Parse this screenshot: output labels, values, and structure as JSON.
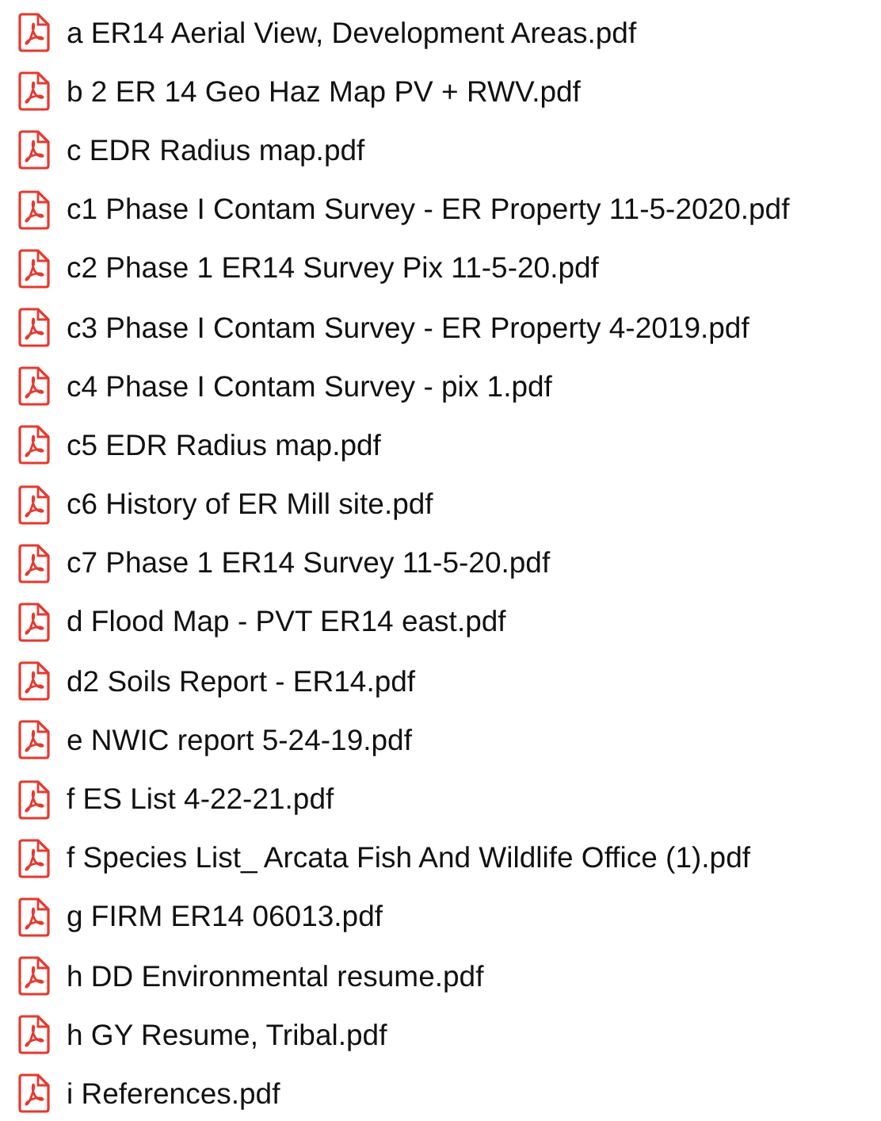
{
  "files": [
    {
      "name": "a ER14 Aerial View, Development Areas.pdf"
    },
    {
      "name": "b 2 ER 14 Geo Haz Map PV + RWV.pdf"
    },
    {
      "name": "c EDR Radius map.pdf"
    },
    {
      "name": "c1 Phase I Contam Survey - ER Property 11-5-2020.pdf"
    },
    {
      "name": "c2 Phase 1 ER14 Survey Pix 11-5-20.pdf"
    },
    {
      "name": "c3 Phase I Contam Survey - ER Property 4-2019.pdf"
    },
    {
      "name": "c4 Phase I Contam Survey - pix 1.pdf"
    },
    {
      "name": "c5 EDR Radius map.pdf"
    },
    {
      "name": "c6 History of ER Mill site.pdf"
    },
    {
      "name": "c7 Phase 1 ER14 Survey 11-5-20.pdf"
    },
    {
      "name": "d Flood Map - PVT ER14 east.pdf"
    },
    {
      "name": "d2 Soils Report - ER14.pdf"
    },
    {
      "name": "e NWIC report 5-24-19.pdf"
    },
    {
      "name": "f ES List 4-22-21.pdf"
    },
    {
      "name": "f Species List_ Arcata Fish And Wildlife Office (1).pdf"
    },
    {
      "name": "g FIRM ER14 06013.pdf"
    },
    {
      "name": "h DD Environmental resume.pdf"
    },
    {
      "name": "h GY Resume, Tribal.pdf"
    },
    {
      "name": "i References.pdf"
    }
  ]
}
